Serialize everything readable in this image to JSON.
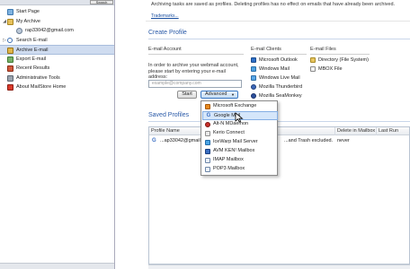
{
  "sidebar": {
    "search_button": "Search",
    "items": [
      {
        "label": "Start Page"
      },
      {
        "label": "My Archive"
      },
      {
        "label": "rap33042@gmail.com"
      },
      {
        "label": "Search E-mail"
      },
      {
        "label": "Archive E-mail"
      },
      {
        "label": "Export E-mail"
      },
      {
        "label": "Recent Results"
      },
      {
        "label": "Administrative Tools"
      },
      {
        "label": "About MailStore Home"
      }
    ]
  },
  "info": {
    "text": "Archiving tasks are saved as profiles. Deleting profiles has no effect on emails that have already been archived.",
    "link": "Trademarks..."
  },
  "create_profile": {
    "title": "Create Profile",
    "email_account": {
      "header": "E-mail Account",
      "description": "In order to archive your webmail account, please start by entering your e-mail address:",
      "input_placeholder": "example@company.com",
      "start_button": "Start",
      "advanced_button": "Advanced"
    },
    "email_clients": {
      "header": "E-mail Clients",
      "items": [
        "Microsoft Outlook",
        "Windows Mail",
        "Windows Live Mail",
        "Mozilla Thunderbird",
        "Mozilla SeaMonkey"
      ]
    },
    "email_files": {
      "header": "E-mail Files",
      "items": [
        "Directory (File System)",
        "MBOX File"
      ]
    }
  },
  "saved_profiles": {
    "title": "Saved Profiles",
    "columns": [
      "Profile Name",
      "Delete in Mailbox",
      "Last Run"
    ],
    "rows": [
      {
        "name": "...ap33042@gmail.co",
        "details": "...and Trash excluded.",
        "delete": "never",
        "last_run": ""
      }
    ]
  },
  "dropdown": {
    "items": [
      "Microsoft Exchange",
      "Google Mail",
      "Alt-N MDaemon",
      "Kerio Connect",
      "IceWarp Mail Server",
      "AVM KEN! Mailbox",
      "IMAP Mailbox",
      "POP3 Mailbox"
    ]
  }
}
